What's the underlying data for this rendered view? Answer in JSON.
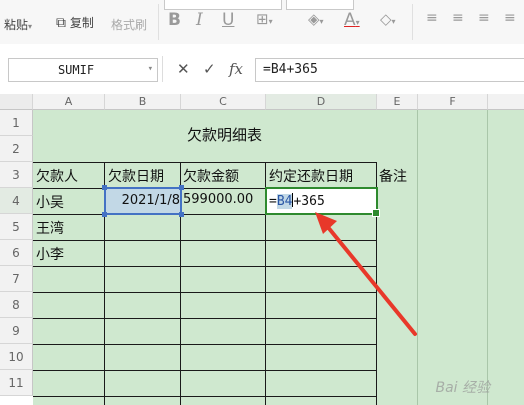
{
  "ribbon": {
    "paste": "粘贴",
    "copy": "复制",
    "format_painter": "格式刷",
    "bold": "B",
    "italic": "I",
    "underline": "U",
    "font_color_glyph": "A"
  },
  "formula_bar": {
    "name_box": "SUMIF",
    "cancel": "✕",
    "accept": "✓",
    "fx": "fx",
    "formula": "=B4+365"
  },
  "columns": [
    "A",
    "B",
    "C",
    "D",
    "E",
    "F"
  ],
  "rows": [
    "1",
    "2",
    "3",
    "4",
    "5",
    "6",
    "7",
    "8",
    "9",
    "10",
    "11"
  ],
  "sheet": {
    "title": "欠款明细表",
    "headers": [
      "欠款人",
      "欠款日期",
      "欠款金额",
      "约定还款日期",
      "备注"
    ],
    "row4": {
      "debtor": "小吴",
      "date": "2021/1/8",
      "amount": "599000.00",
      "edit_prefix": "=",
      "edit_ref": "B4",
      "edit_suffix": "+365"
    },
    "row5": {
      "debtor": "王湾"
    },
    "row6": {
      "debtor": "小李"
    }
  },
  "colors": {
    "sheet_fill": "#cfe8cf",
    "arrow": "#e8382a",
    "selection": "#4472c4",
    "active_border": "#2e8a2e"
  },
  "watermark": "Bai 经验"
}
